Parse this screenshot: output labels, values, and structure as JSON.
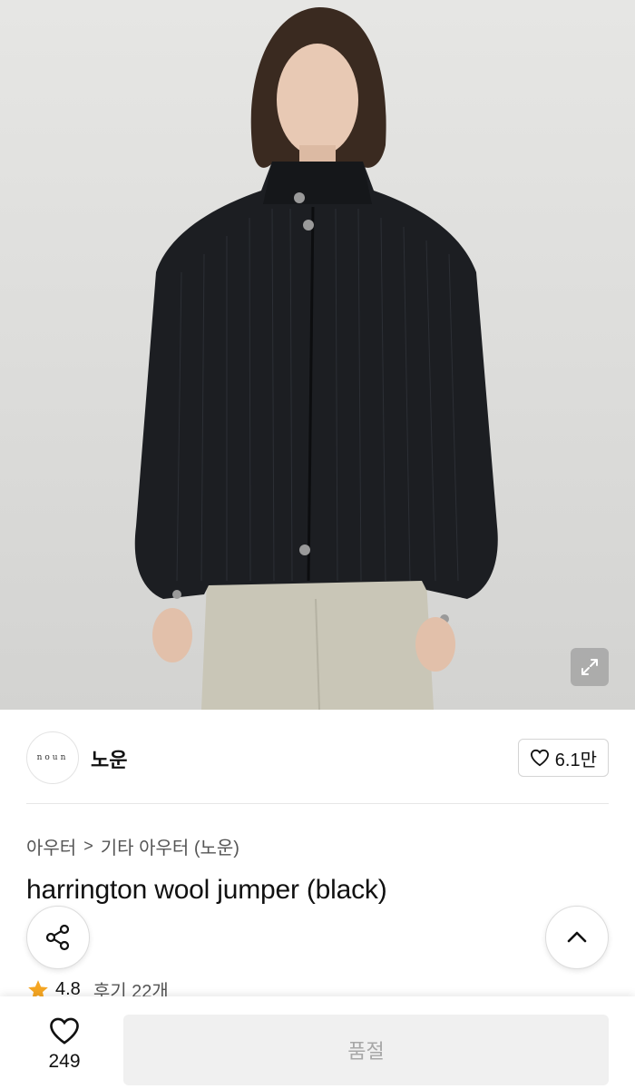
{
  "product_image": {
    "alt": "",
    "expand_icon": "expand-icon"
  },
  "brand": {
    "logo_text": "noun",
    "name": "노운",
    "like_count": "6.1만",
    "heart_icon": "heart-outline-icon"
  },
  "breadcrumb": {
    "items": [
      "아우터",
      "기타 아우터 (노운)"
    ],
    "separator": ">"
  },
  "product": {
    "title": "harrington wool jumper (black)"
  },
  "rating": {
    "score": "4.8",
    "reviews": "후기 22개",
    "star_color": "#f5a623"
  },
  "actions": {
    "share_icon": "share-icon",
    "scroll_top_icon": "chevron-up-icon"
  },
  "bottom_bar": {
    "wish_count": "249",
    "buy_label": "품절"
  }
}
